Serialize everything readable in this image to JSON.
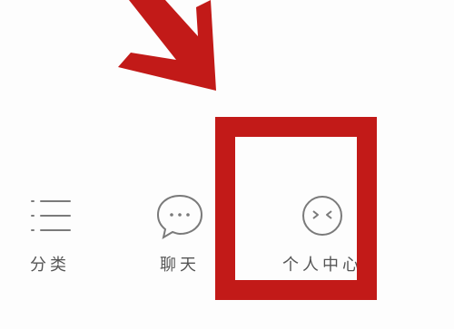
{
  "tabs": [
    {
      "id": "category",
      "label": "分类",
      "icon": "list-icon"
    },
    {
      "id": "chat",
      "label": "聊天",
      "icon": "chat-bubble-icon"
    },
    {
      "id": "profile",
      "label": "个人中心",
      "icon": "smiley-face-icon"
    }
  ],
  "annotation": {
    "color": "#c21a18",
    "highlight_target": "个人中心"
  },
  "colors": {
    "icon_stroke": "#7a7a7a",
    "label_text": "#555555",
    "background": "#fdfdfd"
  }
}
